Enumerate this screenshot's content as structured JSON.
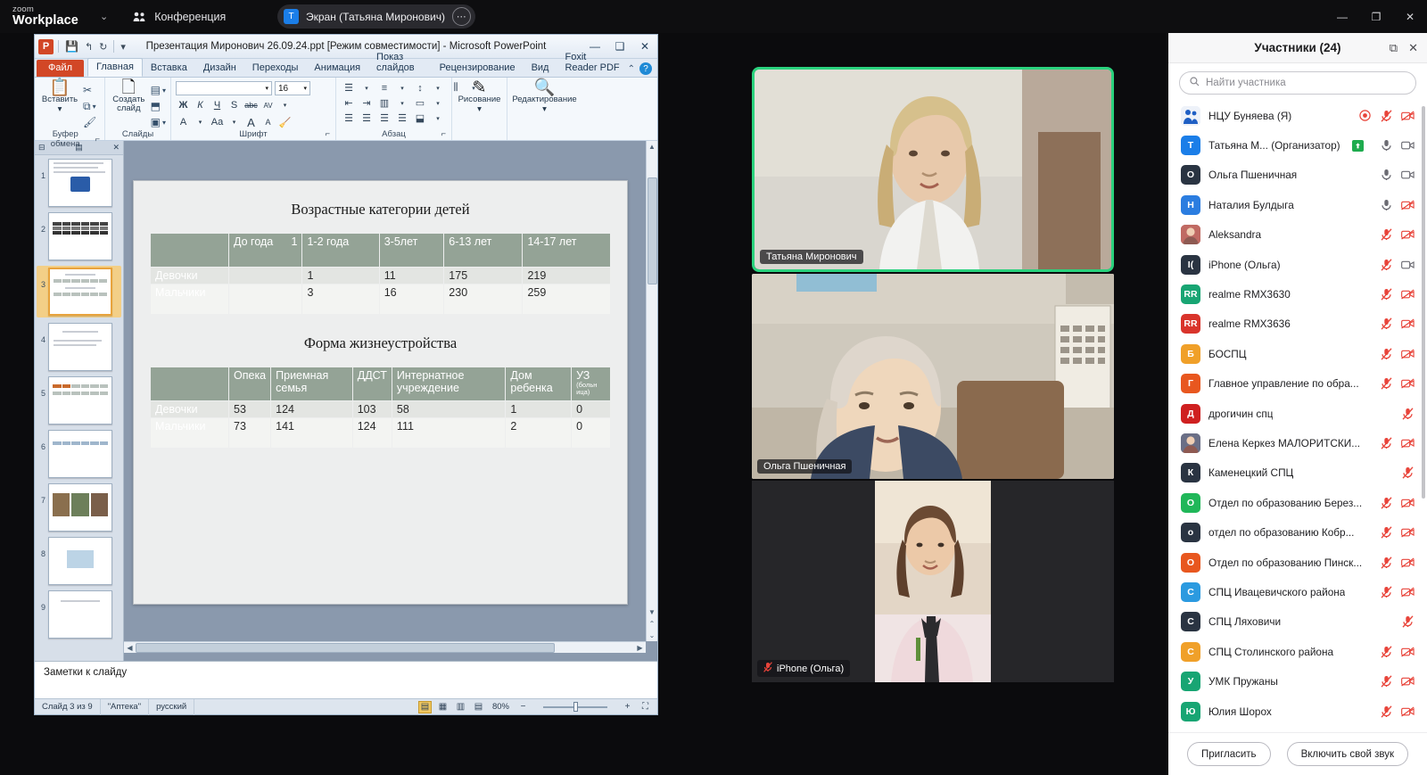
{
  "zoom_bar": {
    "brand_small": "zoom",
    "brand_big": "Workplace",
    "caret": "⌄",
    "conference_label": "Конференция",
    "share_pill": {
      "badge": "T",
      "label": "Экран (Татьяна Миронович)",
      "more": "⋯"
    },
    "window_controls": {
      "minimize": "—",
      "maximize": "❐",
      "close": "✕"
    }
  },
  "powerpoint": {
    "title": "Презентация Миронович 26.09.24.ppt [Режим совместимости]  -  Microsoft PowerPoint",
    "app_badge": "P",
    "quick_access": {
      "save": "💾",
      "undo": "↰",
      "redo": "↻",
      "more": "▾"
    },
    "window_controls": {
      "minimize": "—",
      "maximize": "❑",
      "close": "✕"
    },
    "tabs": [
      {
        "label": "Файл",
        "type": "file"
      },
      {
        "label": "Главная",
        "type": "active"
      },
      {
        "label": "Вставка",
        "type": "normal"
      },
      {
        "label": "Дизайн",
        "type": "normal"
      },
      {
        "label": "Переходы",
        "type": "normal"
      },
      {
        "label": "Анимация",
        "type": "normal"
      },
      {
        "label": "Показ слайдов",
        "type": "normal"
      },
      {
        "label": "Рецензирование",
        "type": "normal"
      },
      {
        "label": "Вид",
        "type": "normal"
      },
      {
        "label": "Foxit Reader PDF",
        "type": "normal"
      }
    ],
    "tab_right": {
      "collapse": "⌃",
      "help": "?"
    },
    "ribbon": {
      "clipboard": {
        "group_label": "Буфер обмена",
        "dialog_launcher": "⌐",
        "paste_label": "Вставить",
        "paste_caret": "▾",
        "cut": "✂",
        "copy": "⧉",
        "format_painter": "🖌"
      },
      "slides": {
        "group_label": "Слайды",
        "new_slide_label": "Создать слайд",
        "new_slide_caret": "▾",
        "layout": "▤",
        "reset": "⬒",
        "section": "▣"
      },
      "font": {
        "group_label": "Шрифт",
        "dialog_launcher": "⌐",
        "font_name_value": "",
        "font_size_value": "16",
        "bold": "Ж",
        "italic": "К",
        "underline": "Ч",
        "shadow": "S",
        "strikethrough": "abc",
        "spacing": "AV",
        "color": "A",
        "case": "Aa",
        "grow": "A",
        "shrink": "A",
        "clear": "🧹"
      },
      "paragraph": {
        "group_label": "Абзац",
        "dialog_launcher": "⌐",
        "bullets": "☰",
        "numbering": "≡",
        "line_spacing": "↕",
        "text_direction": "⫼",
        "dec_indent": "⇤",
        "inc_indent": "⇥",
        "columns": "▥",
        "align_text": "▭",
        "align_left": "☰",
        "align_center": "☰",
        "align_right": "☰",
        "justify": "☰",
        "smartart": "⬓"
      },
      "drawing": {
        "group_label": "Рисование",
        "caret": "▾",
        "icon": "✎"
      },
      "editing": {
        "group_label": "Редактирование",
        "caret": "▾",
        "icon": "🔍"
      }
    },
    "thumbnails_panel": {
      "collapse": "⊟",
      "tab_icon": "▤",
      "close": "✕",
      "slides": [
        "1",
        "2",
        "3",
        "4",
        "5",
        "6",
        "7",
        "8",
        "9"
      ],
      "selected": "3"
    },
    "slide": {
      "table1": {
        "title": "Возрастные категории детей",
        "headers": [
          "",
          "До года",
          "1-2 года",
          "3-5лет",
          "6-13 лет",
          "14-17 лет"
        ],
        "header_corner_number": "1",
        "rows": [
          {
            "label": "Девочки",
            "values": [
              "",
              "1",
              "11",
              "175",
              "219"
            ]
          },
          {
            "label": "Мальчики",
            "values": [
              "",
              "3",
              "16",
              "230",
              "259"
            ]
          }
        ]
      },
      "table2": {
        "title": "Форма жизнеустройства",
        "headers": [
          "",
          "Опека",
          "Приемная семья",
          "ДДСТ",
          "Интернатное учреждение",
          "Дом ребенка",
          "УЗ"
        ],
        "uz_sub": "(больн ица)",
        "rows": [
          {
            "label": "Девочки",
            "values": [
              "53",
              "124",
              "103",
              "58",
              "1",
              "0"
            ]
          },
          {
            "label": "Мальчики",
            "values": [
              "73",
              "141",
              "124",
              "111",
              "2",
              "0"
            ]
          }
        ]
      }
    },
    "notes_placeholder": "Заметки к слайду",
    "status_bar": {
      "slide_info": "Слайд 3 из 9",
      "theme": "\"Аптека\"",
      "language": "русский",
      "zoom_value": "80%",
      "zoom_out": "−",
      "zoom_in": "+",
      "fit_icon": "⛶",
      "views": [
        "▤",
        "▦",
        "▥",
        "▤"
      ]
    },
    "scroll": {
      "up": "▲",
      "down": "▼",
      "left": "◀",
      "right": "▶",
      "prev_slide": "⌃",
      "next_slide": "⌄"
    }
  },
  "video_tiles": [
    {
      "name": "Татьяна Миронович",
      "muted": false,
      "active_speaker": true
    },
    {
      "name": "Ольга Пшеничная",
      "muted": false,
      "active_speaker": false
    },
    {
      "name": "iPhone (Ольга)",
      "muted": true,
      "active_speaker": false
    }
  ],
  "participants_panel": {
    "title": "Участники (24)",
    "popout_icon": "⧉",
    "close_icon": "✕",
    "search_placeholder": "Найти участника",
    "search_icon": "🔍",
    "invite_button": "Пригласить",
    "unmute_button": "Включить свой звук",
    "list": [
      {
        "name": "НЦУ Буняева (Я)",
        "avatar": "photo",
        "color": "#dfe6f2",
        "initial": "",
        "host_badge": false,
        "recording": true,
        "mic": "muted",
        "cam": "off"
      },
      {
        "name": "Татьяна М...   (Организатор)",
        "avatar": "letter",
        "color": "#1b7ee8",
        "initial": "T",
        "host_badge": true,
        "recording": false,
        "mic": "on",
        "cam": "on"
      },
      {
        "name": "Ольга Пшеничная",
        "avatar": "letter",
        "color": "#2a3442",
        "initial": "O",
        "host_badge": false,
        "recording": false,
        "mic": "on",
        "cam": "on"
      },
      {
        "name": "Наталия Булдыга",
        "avatar": "letter",
        "color": "#2b7de0",
        "initial": "Н",
        "host_badge": false,
        "recording": false,
        "mic": "on",
        "cam": "off"
      },
      {
        "name": "Aleksandra",
        "avatar": "photo",
        "color": "#c06a63",
        "initial": "",
        "host_badge": false,
        "recording": false,
        "mic": "muted",
        "cam": "off"
      },
      {
        "name": "iPhone (Ольга)",
        "avatar": "letter",
        "color": "#2a3442",
        "initial": "I(",
        "host_badge": false,
        "recording": false,
        "mic": "muted",
        "cam": "on"
      },
      {
        "name": "realme RMX3630",
        "avatar": "letter",
        "color": "#18a573",
        "initial": "RR",
        "host_badge": false,
        "recording": false,
        "mic": "muted",
        "cam": "off"
      },
      {
        "name": "realme RMX3636",
        "avatar": "letter",
        "color": "#d9342b",
        "initial": "RR",
        "host_badge": false,
        "recording": false,
        "mic": "muted",
        "cam": "off"
      },
      {
        "name": "БОСПЦ",
        "avatar": "letter",
        "color": "#f0a029",
        "initial": "Б",
        "host_badge": false,
        "recording": false,
        "mic": "muted",
        "cam": "off"
      },
      {
        "name": "Главное управление по обра...",
        "avatar": "letter",
        "color": "#e8571f",
        "initial": "Г",
        "host_badge": false,
        "recording": false,
        "mic": "muted",
        "cam": "off"
      },
      {
        "name": "дрогичин спц",
        "avatar": "letter",
        "color": "#cf2020",
        "initial": "Д",
        "host_badge": false,
        "recording": false,
        "mic": "muted",
        "cam": "none"
      },
      {
        "name": "Елена Керкез МАЛОРИТСКИ...",
        "avatar": "photo",
        "color": "#6b6f86",
        "initial": "",
        "host_badge": false,
        "recording": false,
        "mic": "muted",
        "cam": "off"
      },
      {
        "name": "Каменецкий СПЦ",
        "avatar": "letter",
        "color": "#2a3442",
        "initial": "К",
        "host_badge": false,
        "recording": false,
        "mic": "muted",
        "cam": "none"
      },
      {
        "name": "Отдел по образованию Берез...",
        "avatar": "letter",
        "color": "#20b759",
        "initial": "О",
        "host_badge": false,
        "recording": false,
        "mic": "muted",
        "cam": "off"
      },
      {
        "name": "отдел по образованию Кобр...",
        "avatar": "letter",
        "color": "#2a3442",
        "initial": "о",
        "host_badge": false,
        "recording": false,
        "mic": "muted",
        "cam": "off"
      },
      {
        "name": "Отдел по образованию Пинск...",
        "avatar": "letter",
        "color": "#e8571f",
        "initial": "О",
        "host_badge": false,
        "recording": false,
        "mic": "muted",
        "cam": "off"
      },
      {
        "name": "СПЦ Ивацевичского района",
        "avatar": "letter",
        "color": "#2b9ae0",
        "initial": "С",
        "host_badge": false,
        "recording": false,
        "mic": "muted",
        "cam": "off"
      },
      {
        "name": "СПЦ Ляховичи",
        "avatar": "letter",
        "color": "#2a3442",
        "initial": "С",
        "host_badge": false,
        "recording": false,
        "mic": "muted",
        "cam": "none"
      },
      {
        "name": "СПЦ Столинского района",
        "avatar": "letter",
        "color": "#f0a029",
        "initial": "С",
        "host_badge": false,
        "recording": false,
        "mic": "muted",
        "cam": "off"
      },
      {
        "name": "УМК Пружаны",
        "avatar": "letter",
        "color": "#18a573",
        "initial": "У",
        "host_badge": false,
        "recording": false,
        "mic": "muted",
        "cam": "off"
      },
      {
        "name": "Юлия Шорох",
        "avatar": "letter",
        "color": "#18a573",
        "initial": "Ю",
        "host_badge": false,
        "recording": false,
        "mic": "muted",
        "cam": "off"
      }
    ]
  }
}
